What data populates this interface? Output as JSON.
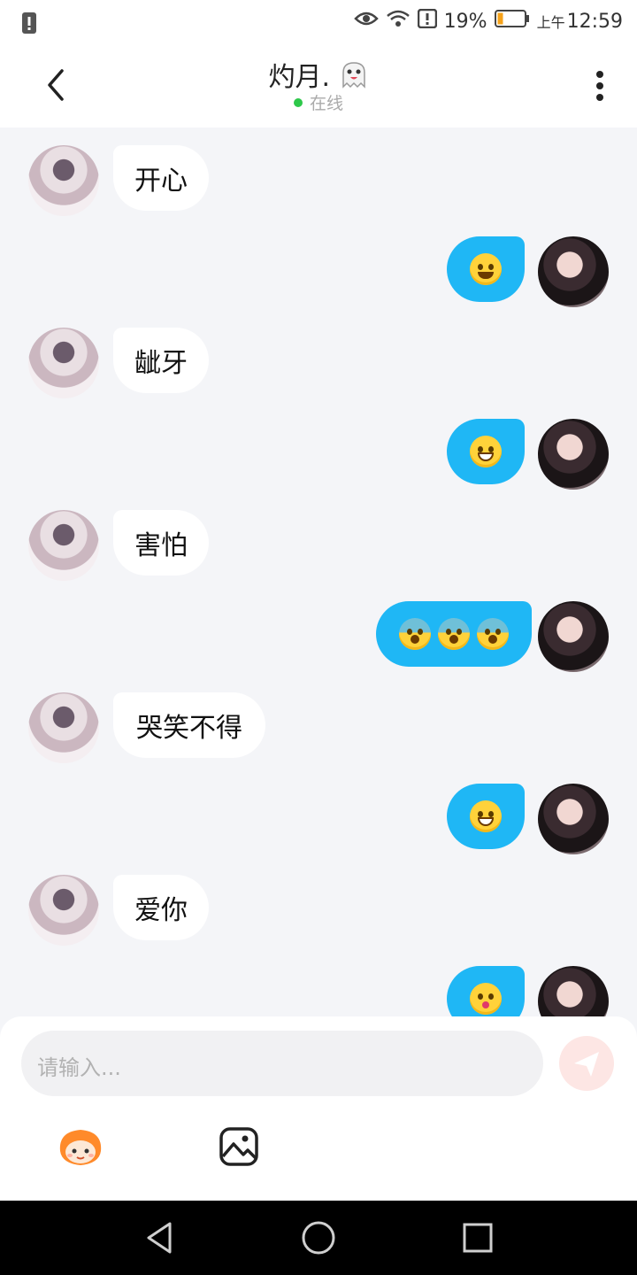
{
  "status_bar": {
    "battery_percent": "19%",
    "time_period": "上午",
    "time": "12:59",
    "icons": [
      "alert-icon",
      "eye-icon",
      "wifi-icon",
      "warning-icon",
      "battery-icon"
    ]
  },
  "header": {
    "contact_name": "灼月.",
    "status": "在线",
    "online_color": "#2ec84a"
  },
  "messages": [
    {
      "sender": "them",
      "text": "开心"
    },
    {
      "sender": "me",
      "emojis": [
        "smile"
      ]
    },
    {
      "sender": "them",
      "text": "龇牙"
    },
    {
      "sender": "me",
      "emojis": [
        "grin"
      ]
    },
    {
      "sender": "them",
      "text": "害怕"
    },
    {
      "sender": "me",
      "emojis": [
        "fear",
        "fear",
        "fear"
      ]
    },
    {
      "sender": "them",
      "text": "哭笑不得"
    },
    {
      "sender": "me",
      "emojis": [
        "laugh"
      ]
    },
    {
      "sender": "them",
      "text": "爱你"
    },
    {
      "sender": "me",
      "emojis": [
        "kiss"
      ]
    }
  ],
  "input": {
    "placeholder": "请输入..."
  },
  "colors": {
    "accent": "#1fb7f5",
    "background": "#f4f5f8",
    "send_button": "#fde6e4"
  }
}
